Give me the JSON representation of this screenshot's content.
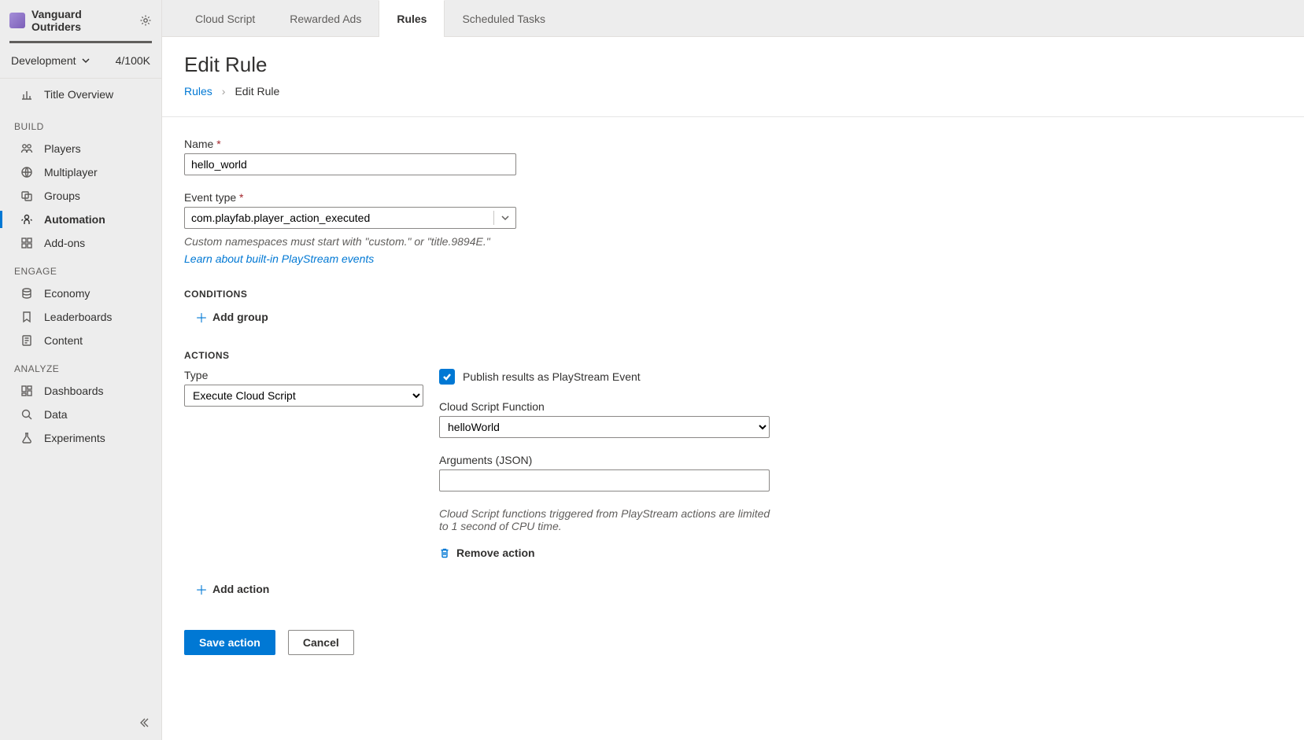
{
  "studio": {
    "name": "Vanguard Outriders"
  },
  "env": {
    "label": "Development",
    "count": "4/100K"
  },
  "nav": {
    "overview": "Title Overview",
    "sections": {
      "build": "BUILD",
      "engage": "ENGAGE",
      "analyze": "ANALYZE"
    },
    "items": {
      "players": "Players",
      "multiplayer": "Multiplayer",
      "groups": "Groups",
      "automation": "Automation",
      "addons": "Add-ons",
      "economy": "Economy",
      "leaderboards": "Leaderboards",
      "content": "Content",
      "dashboards": "Dashboards",
      "data": "Data",
      "experiments": "Experiments"
    }
  },
  "tabs": {
    "cloudscript": "Cloud Script",
    "rewarded": "Rewarded Ads",
    "rules": "Rules",
    "scheduled": "Scheduled Tasks"
  },
  "page": {
    "title": "Edit Rule",
    "crumb_root": "Rules",
    "crumb_current": "Edit Rule"
  },
  "form": {
    "name_label": "Name",
    "name_value": "hello_world",
    "eventtype_label": "Event type",
    "eventtype_value": "com.playfab.player_action_executed",
    "namespace_helper": "Custom namespaces must start with \"custom.\" or \"title.9894E.\"",
    "learn_link": "Learn about built-in PlayStream events",
    "conditions_header": "CONDITIONS",
    "add_group": "Add group",
    "actions_header": "ACTIONS",
    "type_label": "Type",
    "type_value": "Execute Cloud Script",
    "publish_label": "Publish results as PlayStream Event",
    "func_label": "Cloud Script Function",
    "func_value": "helloWorld",
    "args_label": "Arguments (JSON)",
    "args_value": "",
    "cpu_helper": "Cloud Script functions triggered from PlayStream actions are limited to 1 second of CPU time.",
    "remove_action": "Remove action",
    "add_action": "Add action",
    "save": "Save action",
    "cancel": "Cancel"
  }
}
